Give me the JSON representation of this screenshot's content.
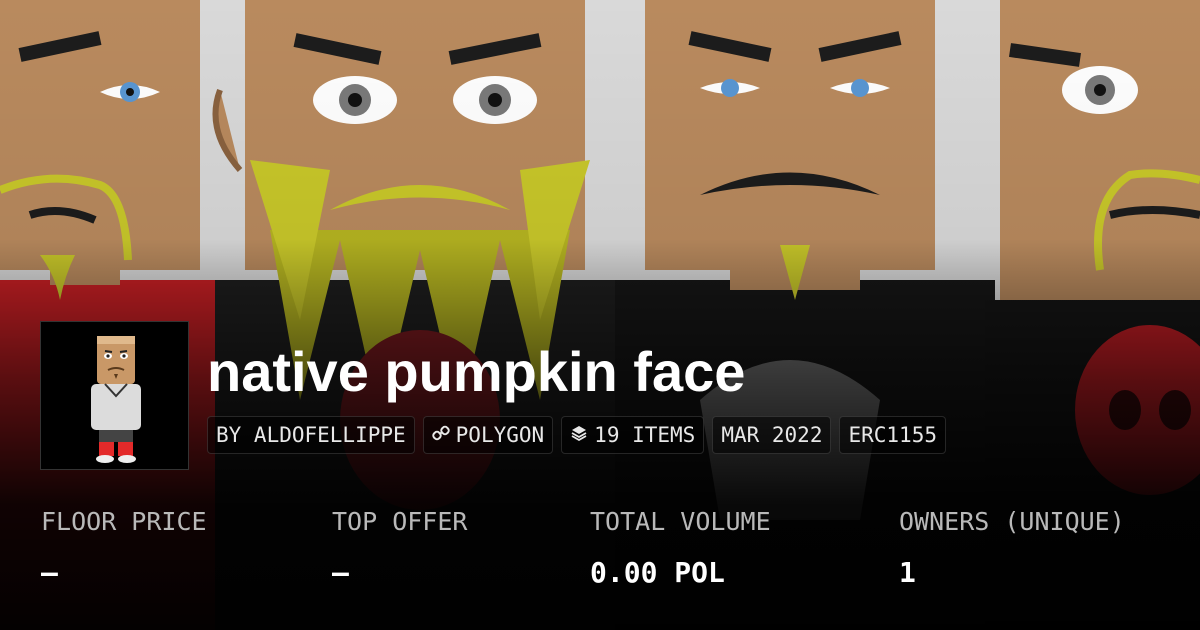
{
  "collection": {
    "title": "native pumpkin face",
    "chips": [
      {
        "icon": "",
        "label": "BY ALDOFELLIPPE"
      },
      {
        "icon": "link-icon",
        "label": "POLYGON"
      },
      {
        "icon": "layers-icon",
        "label": "19 ITEMS"
      },
      {
        "icon": "",
        "label": "MAR 2022"
      },
      {
        "icon": "",
        "label": "ERC1155"
      }
    ]
  },
  "stats": [
    {
      "label": "FLOOR PRICE",
      "value": "–"
    },
    {
      "label": "TOP OFFER",
      "value": "–"
    },
    {
      "label": "TOTAL VOLUME",
      "value": "0.00 POL"
    },
    {
      "label": "OWNERS (UNIQUE)",
      "value": "1"
    }
  ],
  "colors": {
    "background": "#000000",
    "title": "#ffffff",
    "label": "#b9b9b9",
    "chip_border": "#3a3a3a"
  }
}
